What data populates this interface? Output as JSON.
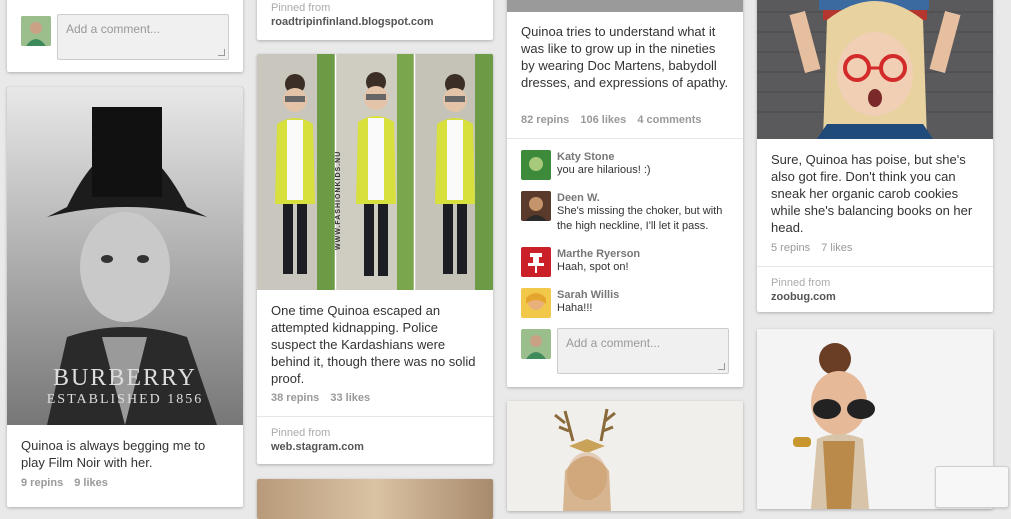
{
  "col1_top": {
    "comment_placeholder": "Add a comment..."
  },
  "col1_pin": {
    "brand_line1": "BURBERRY",
    "brand_line2": "ESTABLISHED 1856",
    "description": "Quinoa is always begging me to play Film Noir with her.",
    "repins": "9 repins",
    "likes": "9 likes"
  },
  "col2_top": {
    "pinned_label": "Pinned from",
    "pinned_url": "roadtripinfinland.blogspot.com"
  },
  "col2_pin": {
    "watermark": "WWW.FASHIONKIDS.NU",
    "description": "One time Quinoa escaped an attempted kidnapping. Police suspect the Kardashians were behind it, though there was no solid proof.",
    "repins": "38 repins",
    "likes": "33 likes",
    "pinned_label": "Pinned from",
    "pinned_url": "web.stagram.com"
  },
  "col3_pin": {
    "description": "Quinoa tries to understand what it was like to grow up in the nineties by wearing Doc Martens, babydoll dresses, and expressions of apathy.",
    "repins": "82 repins",
    "likes": "106 likes",
    "comments_count": "4 comments",
    "comments": [
      {
        "name": "Katy Stone",
        "text": "you are hilarious! :)"
      },
      {
        "name": "Deen W.",
        "text": "She's missing the choker, but with the high neckline, I'll let it pass."
      },
      {
        "name": "Marthe Ryerson",
        "text": "Haah, spot on!"
      },
      {
        "name": "Sarah Willis",
        "text": "Haha!!!"
      }
    ],
    "comment_placeholder": "Add a comment..."
  },
  "col4_pin": {
    "description": "Sure, Quinoa has poise, but she's also got fire. Don't think you can sneak her organic carob cookies while she's balancing books on her head.",
    "repins": "5 repins",
    "likes": "7 likes",
    "pinned_label": "Pinned from",
    "pinned_url": "zoobug.com"
  },
  "colors": {
    "background": "#e9e9e9",
    "card": "#ffffff",
    "muted_text": "#999999",
    "pin_red": "#cb2027"
  }
}
